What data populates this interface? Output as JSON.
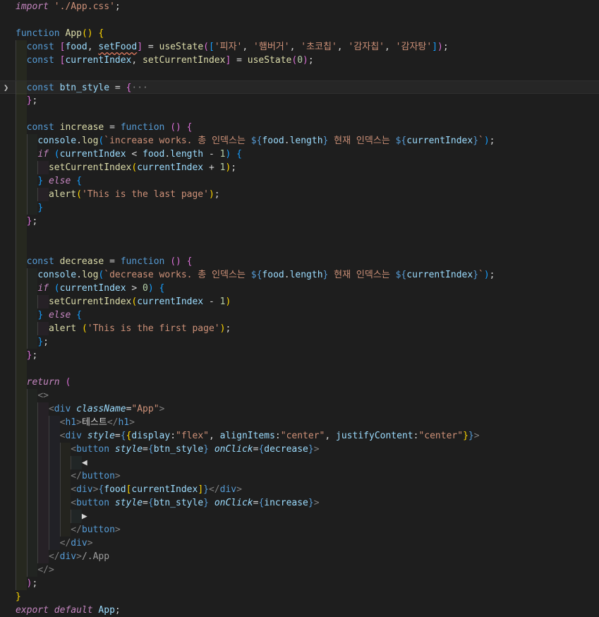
{
  "editor": {
    "language": "javascript",
    "lines": [
      [
        [
          "kwi",
          "import"
        ],
        [
          "op",
          " "
        ],
        [
          "str",
          "'./App.css'"
        ],
        [
          "op",
          ";"
        ]
      ],
      [],
      [
        [
          "st",
          "function"
        ],
        [
          "op",
          " "
        ],
        [
          "fn",
          "App"
        ],
        [
          "b1",
          "()"
        ],
        [
          "op",
          " "
        ],
        [
          "b1",
          "{"
        ]
      ],
      [
        [
          "op",
          "  "
        ],
        [
          "st",
          "const"
        ],
        [
          "op",
          " "
        ],
        [
          "b2",
          "["
        ],
        [
          "var",
          "food"
        ],
        [
          "op",
          ", "
        ],
        [
          "sq",
          "setFood"
        ],
        [
          "b2",
          "]"
        ],
        [
          "op",
          " = "
        ],
        [
          "fn",
          "useState"
        ],
        [
          "b2",
          "("
        ],
        [
          "b3",
          "["
        ],
        [
          "str",
          "'피자'"
        ],
        [
          "op",
          ", "
        ],
        [
          "str",
          "'햄버거'"
        ],
        [
          "op",
          ", "
        ],
        [
          "str",
          "'초코칩'"
        ],
        [
          "op",
          ", "
        ],
        [
          "str",
          "'감자칩'"
        ],
        [
          "op",
          ", "
        ],
        [
          "str",
          "'감자탕'"
        ],
        [
          "b3",
          "]"
        ],
        [
          "b2",
          ")"
        ],
        [
          "op",
          ";"
        ]
      ],
      [
        [
          "op",
          "  "
        ],
        [
          "st",
          "const"
        ],
        [
          "op",
          " "
        ],
        [
          "b2",
          "["
        ],
        [
          "var",
          "currentIndex"
        ],
        [
          "op",
          ", "
        ],
        [
          "fn",
          "setCurrentIndex"
        ],
        [
          "b2",
          "]"
        ],
        [
          "op",
          " = "
        ],
        [
          "fn",
          "useState"
        ],
        [
          "b2",
          "("
        ],
        [
          "num",
          "0"
        ],
        [
          "b2",
          ")"
        ],
        [
          "op",
          ";"
        ]
      ],
      [],
      [
        [
          "op",
          "  "
        ],
        [
          "st",
          "const"
        ],
        [
          "op",
          " "
        ],
        [
          "var",
          "btn_style"
        ],
        [
          "op",
          " = "
        ],
        [
          "b2",
          "{"
        ],
        [
          "fade",
          "···"
        ]
      ],
      [
        [
          "op",
          "  "
        ],
        [
          "b2",
          "}"
        ],
        [
          "op",
          ";"
        ]
      ],
      [],
      [
        [
          "op",
          "  "
        ],
        [
          "st",
          "const"
        ],
        [
          "op",
          " "
        ],
        [
          "fn",
          "increase"
        ],
        [
          "op",
          " = "
        ],
        [
          "st",
          "function"
        ],
        [
          "op",
          " "
        ],
        [
          "b2",
          "()"
        ],
        [
          "op",
          " "
        ],
        [
          "b2",
          "{"
        ]
      ],
      [
        [
          "op",
          "    "
        ],
        [
          "var",
          "console"
        ],
        [
          "op",
          "."
        ],
        [
          "fn",
          "log"
        ],
        [
          "b3",
          "("
        ],
        [
          "str",
          "`increase works. 총 인덱스는 "
        ],
        [
          "st",
          "${"
        ],
        [
          "var",
          "food"
        ],
        [
          "op",
          "."
        ],
        [
          "var",
          "length"
        ],
        [
          "st",
          "}"
        ],
        [
          "str",
          " 현재 인덱스는 "
        ],
        [
          "st",
          "${"
        ],
        [
          "var",
          "currentIndex"
        ],
        [
          "st",
          "}"
        ],
        [
          "str",
          "`"
        ],
        [
          "b3",
          ")"
        ],
        [
          "op",
          ";"
        ]
      ],
      [
        [
          "op",
          "    "
        ],
        [
          "kwi",
          "if"
        ],
        [
          "op",
          " "
        ],
        [
          "b3",
          "("
        ],
        [
          "var",
          "currentIndex"
        ],
        [
          "op",
          " < "
        ],
        [
          "var",
          "food"
        ],
        [
          "op",
          "."
        ],
        [
          "var",
          "length"
        ],
        [
          "op",
          " - "
        ],
        [
          "num",
          "1"
        ],
        [
          "b3",
          ")"
        ],
        [
          "op",
          " "
        ],
        [
          "b3",
          "{"
        ]
      ],
      [
        [
          "op",
          "      "
        ],
        [
          "fn",
          "setCurrentIndex"
        ],
        [
          "b1",
          "("
        ],
        [
          "var",
          "currentIndex"
        ],
        [
          "op",
          " + "
        ],
        [
          "num",
          "1"
        ],
        [
          "b1",
          ")"
        ],
        [
          "op",
          ";"
        ]
      ],
      [
        [
          "op",
          "    "
        ],
        [
          "b3",
          "}"
        ],
        [
          "op",
          " "
        ],
        [
          "kwi",
          "else"
        ],
        [
          "op",
          " "
        ],
        [
          "b3",
          "{"
        ]
      ],
      [
        [
          "op",
          "      "
        ],
        [
          "fn",
          "alert"
        ],
        [
          "b1",
          "("
        ],
        [
          "str",
          "'This is the last page'"
        ],
        [
          "b1",
          ")"
        ],
        [
          "op",
          ";"
        ]
      ],
      [
        [
          "op",
          "    "
        ],
        [
          "b3",
          "}"
        ]
      ],
      [
        [
          "op",
          "  "
        ],
        [
          "b2",
          "}"
        ],
        [
          "op",
          ";"
        ]
      ],
      [],
      [],
      [
        [
          "op",
          "  "
        ],
        [
          "st",
          "const"
        ],
        [
          "op",
          " "
        ],
        [
          "fn",
          "decrease"
        ],
        [
          "op",
          " = "
        ],
        [
          "st",
          "function"
        ],
        [
          "op",
          " "
        ],
        [
          "b2",
          "()"
        ],
        [
          "op",
          " "
        ],
        [
          "b2",
          "{"
        ]
      ],
      [
        [
          "op",
          "    "
        ],
        [
          "var",
          "console"
        ],
        [
          "op",
          "."
        ],
        [
          "fn",
          "log"
        ],
        [
          "b3",
          "("
        ],
        [
          "str",
          "`decrease works. 총 인덱스는 "
        ],
        [
          "st",
          "${"
        ],
        [
          "var",
          "food"
        ],
        [
          "op",
          "."
        ],
        [
          "var",
          "length"
        ],
        [
          "st",
          "}"
        ],
        [
          "str",
          " 현재 인덱스는 "
        ],
        [
          "st",
          "${"
        ],
        [
          "var",
          "currentIndex"
        ],
        [
          "st",
          "}"
        ],
        [
          "str",
          "`"
        ],
        [
          "b3",
          ")"
        ],
        [
          "op",
          ";"
        ]
      ],
      [
        [
          "op",
          "    "
        ],
        [
          "kwi",
          "if"
        ],
        [
          "op",
          " "
        ],
        [
          "b3",
          "("
        ],
        [
          "var",
          "currentIndex"
        ],
        [
          "op",
          " > "
        ],
        [
          "num",
          "0"
        ],
        [
          "b3",
          ")"
        ],
        [
          "op",
          " "
        ],
        [
          "b3",
          "{"
        ]
      ],
      [
        [
          "op",
          "      "
        ],
        [
          "fn",
          "setCurrentIndex"
        ],
        [
          "b1",
          "("
        ],
        [
          "var",
          "currentIndex"
        ],
        [
          "op",
          " - "
        ],
        [
          "num",
          "1"
        ],
        [
          "b1",
          ")"
        ]
      ],
      [
        [
          "op",
          "    "
        ],
        [
          "b3",
          "}"
        ],
        [
          "op",
          " "
        ],
        [
          "kwi",
          "else"
        ],
        [
          "op",
          " "
        ],
        [
          "b3",
          "{"
        ]
      ],
      [
        [
          "op",
          "      "
        ],
        [
          "fn",
          "alert"
        ],
        [
          "op",
          " "
        ],
        [
          "b1",
          "("
        ],
        [
          "str",
          "'This is the first page'"
        ],
        [
          "b1",
          ")"
        ],
        [
          "op",
          ";"
        ]
      ],
      [
        [
          "op",
          "    "
        ],
        [
          "b3",
          "}"
        ],
        [
          "op",
          ";"
        ]
      ],
      [
        [
          "op",
          "  "
        ],
        [
          "b2",
          "}"
        ],
        [
          "op",
          ";"
        ]
      ],
      [],
      [
        [
          "op",
          "  "
        ],
        [
          "kwi",
          "return"
        ],
        [
          "op",
          " "
        ],
        [
          "b2",
          "("
        ]
      ],
      [
        [
          "op",
          "    "
        ],
        [
          "tagp",
          "<>"
        ]
      ],
      [
        [
          "op",
          "      "
        ],
        [
          "tagp",
          "<"
        ],
        [
          "tag",
          "div"
        ],
        [
          "op",
          " "
        ],
        [
          "attr",
          "className"
        ],
        [
          "op",
          "="
        ],
        [
          "str",
          "\"App\""
        ],
        [
          "tagp",
          ">"
        ]
      ],
      [
        [
          "op",
          "        "
        ],
        [
          "tagp",
          "<"
        ],
        [
          "tag",
          "h1"
        ],
        [
          "tagp",
          ">"
        ],
        [
          "op",
          "테스트"
        ],
        [
          "tagp",
          "</"
        ],
        [
          "tag",
          "h1"
        ],
        [
          "tagp",
          ">"
        ]
      ],
      [
        [
          "op",
          "        "
        ],
        [
          "tagp",
          "<"
        ],
        [
          "tag",
          "div"
        ],
        [
          "op",
          " "
        ],
        [
          "attr",
          "style"
        ],
        [
          "op",
          "="
        ],
        [
          "st",
          "{"
        ],
        [
          "b1",
          "{"
        ],
        [
          "var",
          "display"
        ],
        [
          "op",
          ":"
        ],
        [
          "str",
          "\"flex\""
        ],
        [
          "op",
          ", "
        ],
        [
          "var",
          "alignItems"
        ],
        [
          "op",
          ":"
        ],
        [
          "str",
          "\"center\""
        ],
        [
          "op",
          ", "
        ],
        [
          "var",
          "justifyContent"
        ],
        [
          "op",
          ":"
        ],
        [
          "str",
          "\"center\""
        ],
        [
          "b1",
          "}"
        ],
        [
          "st",
          "}"
        ],
        [
          "tagp",
          ">"
        ]
      ],
      [
        [
          "op",
          "          "
        ],
        [
          "tagp",
          "<"
        ],
        [
          "tag",
          "button"
        ],
        [
          "op",
          " "
        ],
        [
          "attr",
          "style"
        ],
        [
          "op",
          "="
        ],
        [
          "st",
          "{"
        ],
        [
          "var",
          "btn_style"
        ],
        [
          "st",
          "}"
        ],
        [
          "op",
          " "
        ],
        [
          "attr",
          "onClick"
        ],
        [
          "op",
          "="
        ],
        [
          "st",
          "{"
        ],
        [
          "var",
          "decrease"
        ],
        [
          "st",
          "}"
        ],
        [
          "tagp",
          ">"
        ]
      ],
      [
        [
          "op",
          "            "
        ],
        [
          "op",
          "◀"
        ]
      ],
      [
        [
          "op",
          "          "
        ],
        [
          "tagp",
          "</"
        ],
        [
          "tag",
          "button"
        ],
        [
          "tagp",
          ">"
        ]
      ],
      [
        [
          "op",
          "          "
        ],
        [
          "tagp",
          "<"
        ],
        [
          "tag",
          "div"
        ],
        [
          "tagp",
          ">"
        ],
        [
          "st",
          "{"
        ],
        [
          "var",
          "food"
        ],
        [
          "b1",
          "["
        ],
        [
          "var",
          "currentIndex"
        ],
        [
          "b1",
          "]"
        ],
        [
          "st",
          "}"
        ],
        [
          "tagp",
          "</"
        ],
        [
          "tag",
          "div"
        ],
        [
          "tagp",
          ">"
        ]
      ],
      [
        [
          "op",
          "          "
        ],
        [
          "tagp",
          "<"
        ],
        [
          "tag",
          "button"
        ],
        [
          "op",
          " "
        ],
        [
          "attr",
          "style"
        ],
        [
          "op",
          "="
        ],
        [
          "st",
          "{"
        ],
        [
          "var",
          "btn_style"
        ],
        [
          "st",
          "}"
        ],
        [
          "op",
          " "
        ],
        [
          "attr",
          "onClick"
        ],
        [
          "op",
          "="
        ],
        [
          "st",
          "{"
        ],
        [
          "var",
          "increase"
        ],
        [
          "st",
          "}"
        ],
        [
          "tagp",
          ">"
        ]
      ],
      [
        [
          "op",
          "            "
        ],
        [
          "op",
          "▶"
        ]
      ],
      [
        [
          "op",
          "          "
        ],
        [
          "tagp",
          "</"
        ],
        [
          "tag",
          "button"
        ],
        [
          "tagp",
          ">"
        ]
      ],
      [
        [
          "op",
          "        "
        ],
        [
          "tagp",
          "</"
        ],
        [
          "tag",
          "div"
        ],
        [
          "tagp",
          ">"
        ]
      ],
      [
        [
          "op",
          "      "
        ],
        [
          "tagp",
          "</"
        ],
        [
          "tag",
          "div"
        ],
        [
          "tagp",
          ">"
        ],
        [
          "cmt",
          "/.App"
        ]
      ],
      [
        [
          "op",
          "    "
        ],
        [
          "tagp",
          "</>"
        ]
      ],
      [
        [
          "op",
          "  "
        ],
        [
          "b2",
          ")"
        ],
        [
          "op",
          ";"
        ]
      ],
      [
        [
          "b1",
          "}"
        ]
      ],
      [
        [
          "kwi",
          "export"
        ],
        [
          "op",
          " "
        ],
        [
          "kwi",
          "default"
        ],
        [
          "op",
          " "
        ],
        [
          "var",
          "App"
        ],
        [
          "op",
          ";"
        ]
      ]
    ],
    "guides": [
      [],
      [],
      [],
      [
        1
      ],
      [
        1
      ],
      [
        1
      ],
      [
        1
      ],
      [
        1
      ],
      [
        1
      ],
      [
        1
      ],
      [
        1,
        2
      ],
      [
        1,
        2
      ],
      [
        1,
        2,
        3
      ],
      [
        1,
        2
      ],
      [
        1,
        2,
        3
      ],
      [
        1,
        2
      ],
      [
        1
      ],
      [
        1
      ],
      [
        1
      ],
      [
        1
      ],
      [
        1,
        2
      ],
      [
        1,
        2
      ],
      [
        1,
        2,
        3
      ],
      [
        1,
        2
      ],
      [
        1,
        2,
        3
      ],
      [
        1,
        2
      ],
      [
        1
      ],
      [
        1
      ],
      [
        1
      ],
      [
        1,
        2
      ],
      [
        1,
        2,
        3
      ],
      [
        1,
        2,
        3,
        4
      ],
      [
        1,
        2,
        3,
        4
      ],
      [
        1,
        2,
        3,
        4,
        5
      ],
      [
        1,
        2,
        3,
        4,
        5,
        6
      ],
      [
        1,
        2,
        3,
        4,
        5
      ],
      [
        1,
        2,
        3,
        4,
        5
      ],
      [
        1,
        2,
        3,
        4,
        5
      ],
      [
        1,
        2,
        3,
        4,
        5,
        6
      ],
      [
        1,
        2,
        3,
        4,
        5
      ],
      [
        1,
        2,
        3,
        4
      ],
      [
        1,
        2,
        3
      ],
      [
        1,
        2
      ],
      [
        1
      ],
      [],
      []
    ],
    "current_line": 6,
    "fold_line": 6
  }
}
